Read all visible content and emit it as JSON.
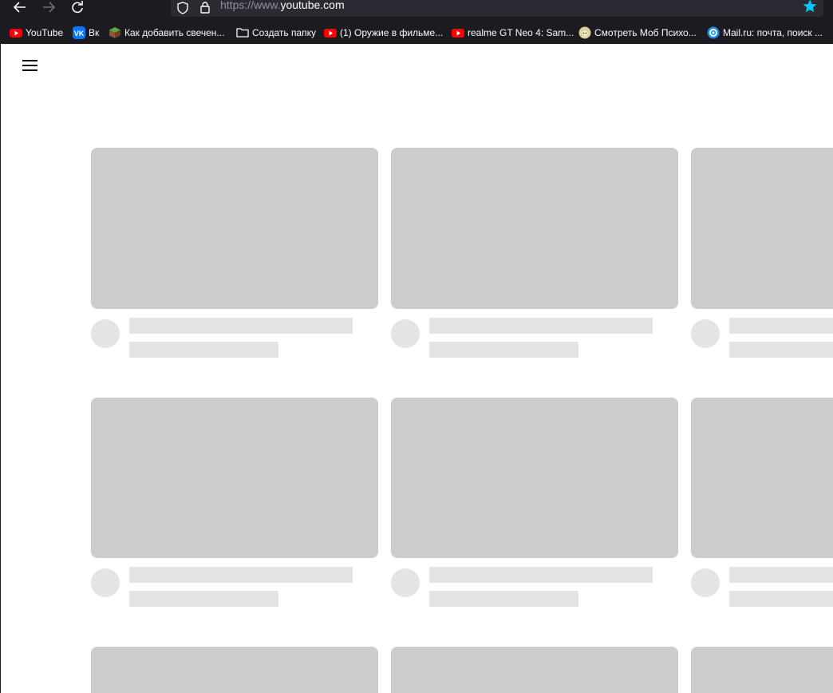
{
  "browser": {
    "url_prefix": "https://www.",
    "url_domain": "youtube.com",
    "bookmark_star_color": "#00c8ff",
    "bookmarks": [
      {
        "label": "YouTube",
        "icon": "youtube-icon"
      },
      {
        "label": "Вк",
        "icon": "vk-icon"
      },
      {
        "label": "Как добавить свечен...",
        "icon": "minecraft-block-icon"
      },
      {
        "label": "Создать папку",
        "icon": "folder-icon"
      },
      {
        "label": "(1) Оружие в фильме...",
        "icon": "youtube-icon"
      },
      {
        "label": "realme GT Neo 4: Sam...",
        "icon": "youtube-icon"
      },
      {
        "label": "Смотреть Моб Психо...",
        "icon": "anime-avatar-icon"
      },
      {
        "label": "Mail.ru: почта, поиск ...",
        "icon": "mailru-icon"
      }
    ]
  },
  "page": {
    "menu_icon": "hamburger-menu-icon",
    "skeleton_color_thumb": "#cccccc",
    "skeleton_color_text": "#e4e4e4"
  }
}
